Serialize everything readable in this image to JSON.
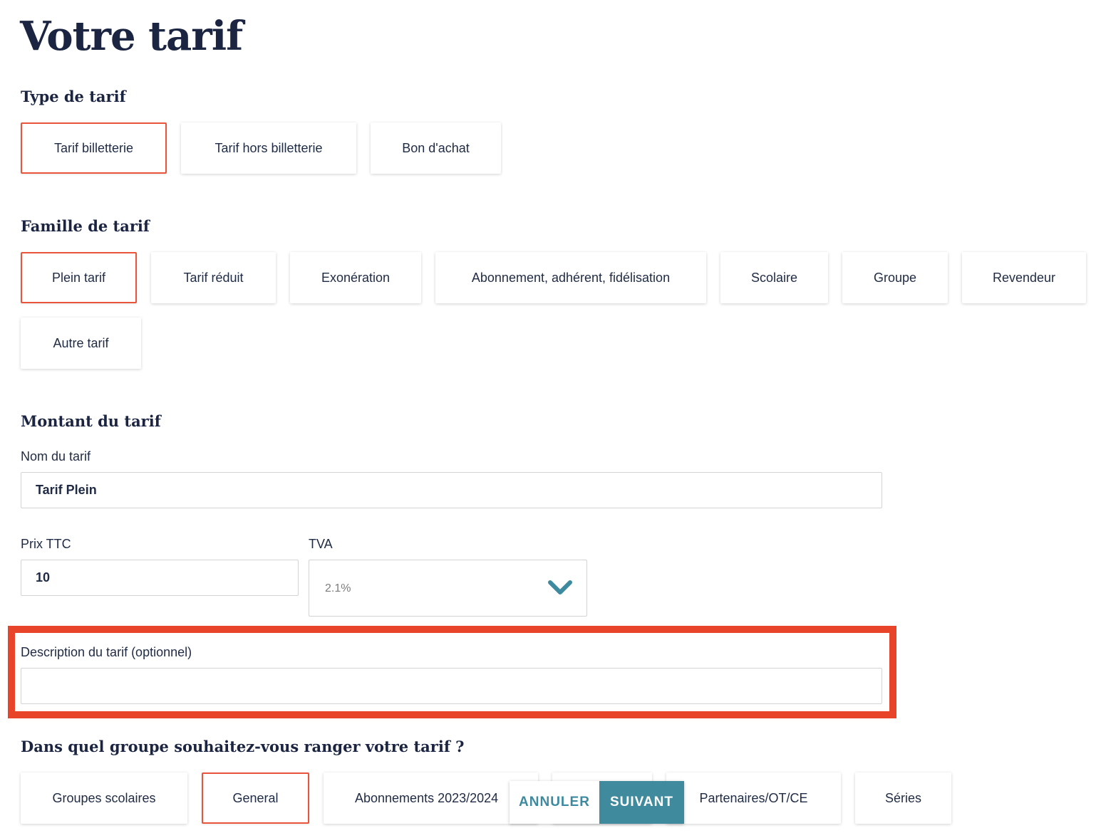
{
  "page_title": "Votre tarif",
  "type_section": {
    "title": "Type de tarif",
    "options": [
      {
        "label": "Tarif billetterie",
        "selected": true
      },
      {
        "label": "Tarif hors billetterie",
        "selected": false
      },
      {
        "label": "Bon d'achat",
        "selected": false
      }
    ]
  },
  "family_section": {
    "title": "Famille de tarif",
    "options": [
      {
        "label": "Plein tarif",
        "selected": true
      },
      {
        "label": "Tarif réduit",
        "selected": false
      },
      {
        "label": "Exonération",
        "selected": false
      },
      {
        "label": "Abonnement, adhérent, fidélisation",
        "selected": false
      },
      {
        "label": "Scolaire",
        "selected": false
      },
      {
        "label": "Groupe",
        "selected": false
      },
      {
        "label": "Revendeur",
        "selected": false
      },
      {
        "label": "Autre tarif",
        "selected": false
      }
    ]
  },
  "amount_section": {
    "title": "Montant du tarif",
    "name_label": "Nom du tarif",
    "name_value": "Tarif Plein",
    "price_label": "Prix TTC",
    "price_value": "10",
    "vat_label": "TVA",
    "vat_value": "2.1%",
    "description_label": "Description du tarif (optionnel)",
    "description_value": ""
  },
  "group_section": {
    "title": "Dans quel groupe souhaitez-vous ranger votre tarif ?",
    "options": [
      {
        "label": "Groupes scolaires",
        "selected": false
      },
      {
        "label": "General",
        "selected": true
      },
      {
        "label": "Abonnements 2023/2024",
        "selected": false
      },
      {
        "label": "",
        "selected": false
      },
      {
        "label": "Partenaires/OT/CE",
        "selected": false
      },
      {
        "label": "Séries",
        "selected": false
      }
    ]
  },
  "actions": {
    "cancel_label": "ANNULER",
    "next_label": "SUIVANT"
  },
  "colors": {
    "selected_border": "#e8553b",
    "highlight": "#e8442a",
    "primary": "#3f8a9c",
    "title": "#1b2542"
  }
}
